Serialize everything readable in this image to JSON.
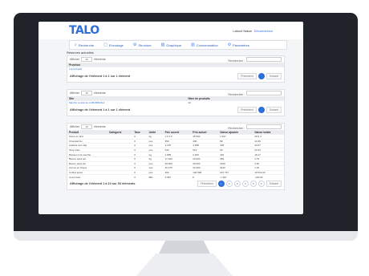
{
  "app": {
    "logo": "TALO",
    "user": "Lakoni Natan",
    "logout": "Déconnexion"
  },
  "nav": [
    {
      "label": "Recherche",
      "icon": "search-icon",
      "glyph": "⌕"
    },
    {
      "label": "Encodage",
      "icon": "document-icon",
      "glyph": "▢"
    },
    {
      "label": "Structure",
      "icon": "gear-icon",
      "glyph": "⚙"
    },
    {
      "label": "Graphique",
      "icon": "chart-icon",
      "glyph": "▥"
    },
    {
      "label": "Consommation",
      "icon": "bar-chart-icon",
      "glyph": "▥"
    },
    {
      "label": "Paramètres",
      "icon": "settings-icon",
      "glyph": "⚙"
    }
  ],
  "section_title": "Réserves actuelles",
  "common": {
    "afficher": "Afficher",
    "elements": "éléments",
    "select_value": "10",
    "recherche": "Rechercher :",
    "previous": "Précédent",
    "next": "Suivant"
  },
  "panel1": {
    "header": "Province",
    "row": "Lubumbashi",
    "info": "Affichage de l'élément 1 à 1 sur 1 élément"
  },
  "panel2": {
    "headers": [
      "Site",
      "Nbre de produits"
    ],
    "row": [
      "Marché central de LUBUMBASHI",
      "10"
    ],
    "info": "Affichage de l'élément 1 à 1 sur 1 élément"
  },
  "panel3": {
    "headers": [
      "Produit",
      "Catégorie",
      "Taxe",
      "Unité",
      "Prix ouvert",
      "Prix actuel",
      "Valeur ajoutée",
      "Valeur totale"
    ],
    "rows": [
      [
        "Sucre en brut",
        "",
        "0",
        "kg",
        "1 0 4 5",
        "45 500",
        "1 497",
        "30 5 4"
      ],
      [
        "Chocolat bio",
        "",
        "0",
        "pce",
        "350",
        "496",
        "89",
        "10.39"
      ],
      [
        "Arabica zest 1kg",
        "",
        "0",
        "pce",
        "3 275",
        "3 488",
        "409",
        "33.67"
      ],
      [
        "Sirop frais",
        "",
        "0",
        "pce",
        "640",
        "512",
        "69",
        "33.33"
      ],
      [
        "Boisson à la menthe",
        "",
        "0",
        "kg",
        "1 895",
        "2 200",
        "426",
        "18.17"
      ],
      [
        "Beurre sans sel",
        "",
        "0",
        "kg",
        "17 400",
        "20 500",
        "489",
        "3.79"
      ],
      [
        "Beurre sans sel",
        "",
        "0",
        "pce",
        "29 000",
        "30 000",
        "3100",
        "3.50"
      ],
      [
        "Crème en brique",
        "",
        "0",
        "can",
        "40 375",
        "30 300",
        "4410",
        "1.36"
      ],
      [
        "Coffret épicé",
        "",
        "0",
        "pce",
        "363",
        "130 598",
        "207 797",
        "19 512.03"
      ],
      [
        "Coca Cola",
        "",
        "0",
        "Btls",
        "2 687",
        "8",
        "-1 997",
        "-100.00"
      ]
    ],
    "info": "Affichage de l'élément 1 à 10 sur 53 éléments",
    "pages": [
      "1",
      "2",
      "3",
      "4",
      "5",
      "6"
    ]
  }
}
